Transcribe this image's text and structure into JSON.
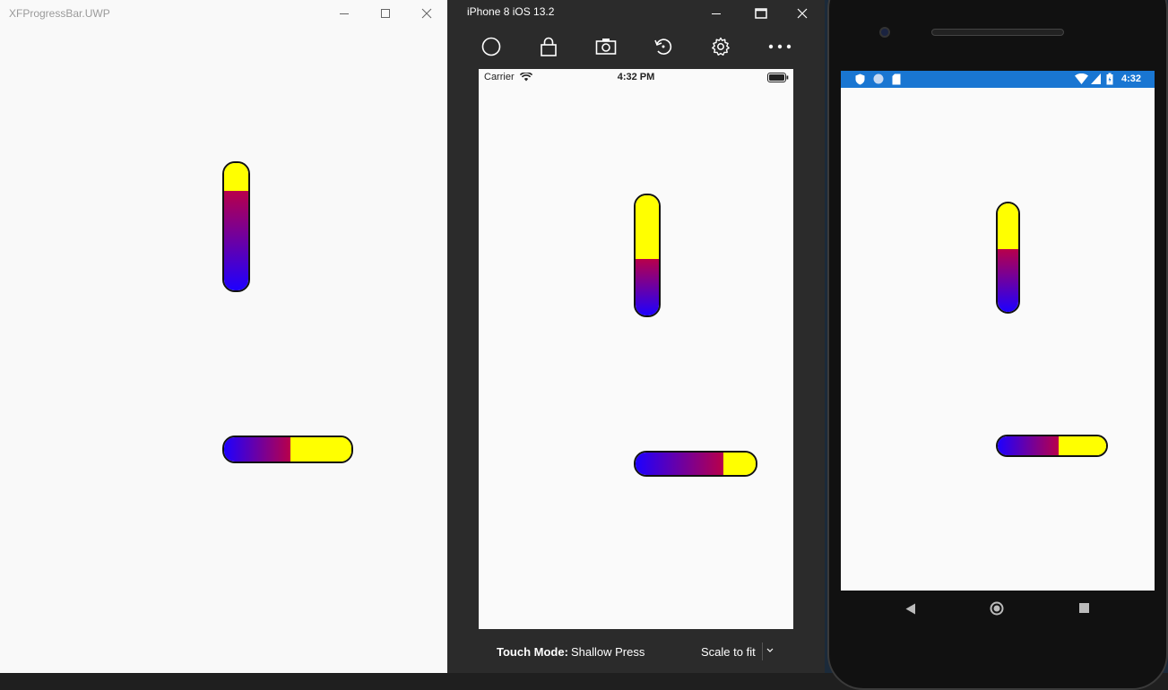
{
  "uwp": {
    "title": "XFProgressBar.UWP"
  },
  "ios": {
    "window_title": "iPhone 8 iOS 13.2",
    "status": {
      "carrier": "Carrier",
      "time": "4:32 PM"
    },
    "footer": {
      "touch_mode_label": "Touch Mode:",
      "touch_mode_value": "Shallow Press",
      "scale_label": "Scale to fit"
    }
  },
  "android": {
    "status": {
      "time": "4:32"
    }
  },
  "progress": {
    "uwp_vertical": 0.78,
    "uwp_horizontal": 0.52,
    "ios_vertical": 0.47,
    "ios_horizontal": 0.73,
    "android_vertical": 0.58,
    "android_horizontal": 0.56
  },
  "colors": {
    "fill_start": "#1e00ff",
    "fill_end": "#b8004a",
    "track": "#ffff00",
    "android_status_bar": "#1976d2"
  }
}
